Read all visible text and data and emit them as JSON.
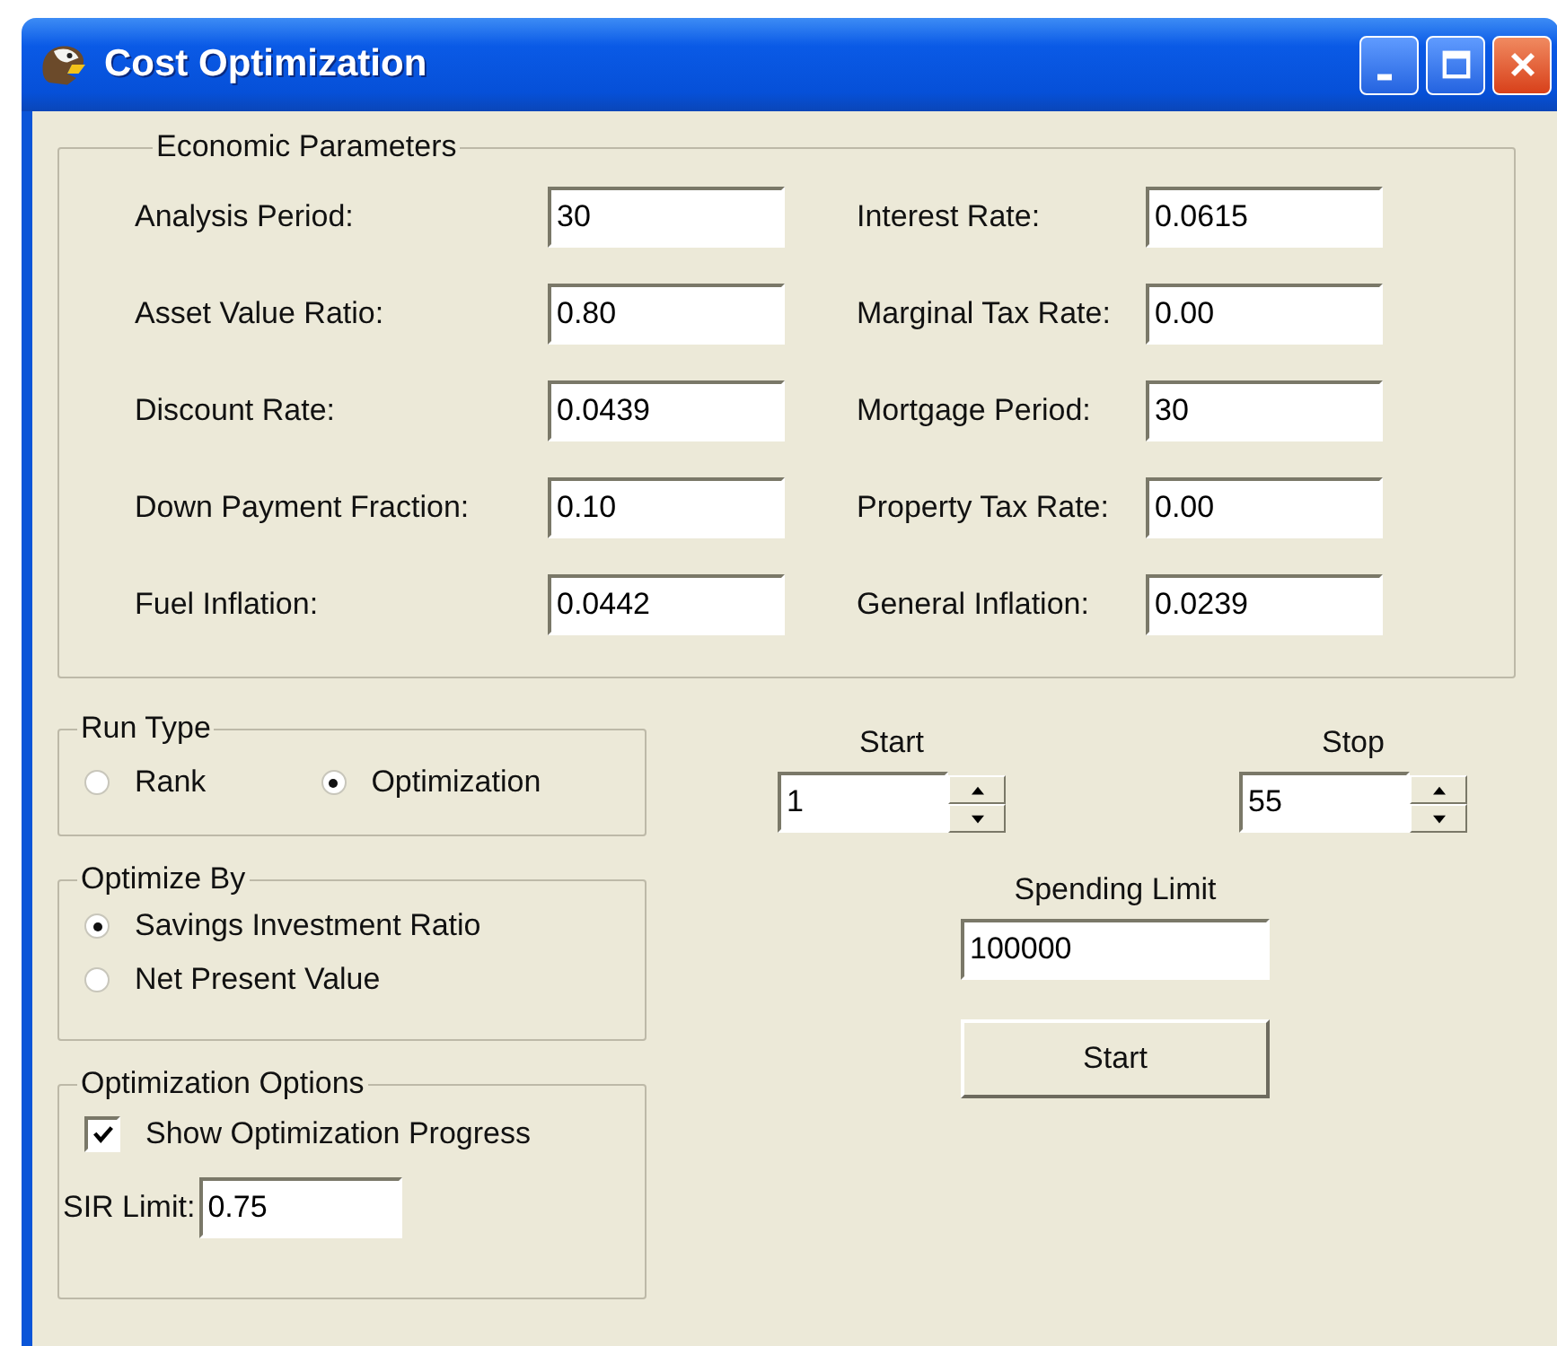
{
  "window": {
    "title": "Cost Optimization"
  },
  "economic_parameters": {
    "title": "Economic Parameters",
    "fields": [
      {
        "label": "Analysis Period:",
        "value": "30"
      },
      {
        "label": "Interest Rate:",
        "value": "0.0615"
      },
      {
        "label": "Asset Value Ratio:",
        "value": "0.80"
      },
      {
        "label": "Marginal Tax Rate:",
        "value": "0.00"
      },
      {
        "label": "Discount Rate:",
        "value": "0.0439"
      },
      {
        "label": "Mortgage Period:",
        "value": "30"
      },
      {
        "label": "Down Payment Fraction:",
        "value": "0.10"
      },
      {
        "label": "Property Tax Rate:",
        "value": "0.00"
      },
      {
        "label": "Fuel Inflation:",
        "value": "0.0442"
      },
      {
        "label": "General Inflation:",
        "value": "0.0239"
      }
    ]
  },
  "run_type": {
    "title": "Run Type",
    "options": [
      {
        "label": "Rank",
        "selected": false
      },
      {
        "label": "Optimization",
        "selected": true
      }
    ]
  },
  "optimize_by": {
    "title": "Optimize By",
    "options": [
      {
        "label": "Savings Investment Ratio",
        "selected": true
      },
      {
        "label": "Net Present Value",
        "selected": false
      }
    ]
  },
  "optimization_options": {
    "title": "Optimization Options",
    "show_progress": {
      "label": "Show Optimization Progress",
      "checked": true
    },
    "sir_limit": {
      "label": "SIR Limit:",
      "value": "0.75"
    }
  },
  "start": {
    "label": "Start",
    "value": "1"
  },
  "stop": {
    "label": "Stop",
    "value": "55"
  },
  "spending_limit": {
    "label": "Spending Limit",
    "value": "100000"
  },
  "start_button": {
    "label": "Start"
  }
}
